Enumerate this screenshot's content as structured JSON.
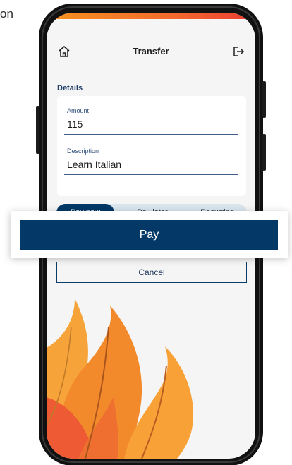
{
  "background": {
    "partial_text": "on"
  },
  "header": {
    "title": "Transfer",
    "left_icon": "home-icon",
    "right_icon": "logout-icon"
  },
  "details": {
    "section_label": "Details",
    "amount": {
      "label": "Amount",
      "value": "115"
    },
    "description": {
      "label": "Description",
      "value": "Learn Italian"
    }
  },
  "payment_options": {
    "items": [
      "Pay now",
      "Pay later",
      "Recurring"
    ],
    "selected": "Pay now"
  },
  "actions": {
    "pay_label": "Pay",
    "cancel_label": "Cancel"
  },
  "colors": {
    "primary": "#033867",
    "segment_bg": "#dbe6ef",
    "accent_orange": "#f7931e",
    "accent_red": "#ea3d33"
  }
}
